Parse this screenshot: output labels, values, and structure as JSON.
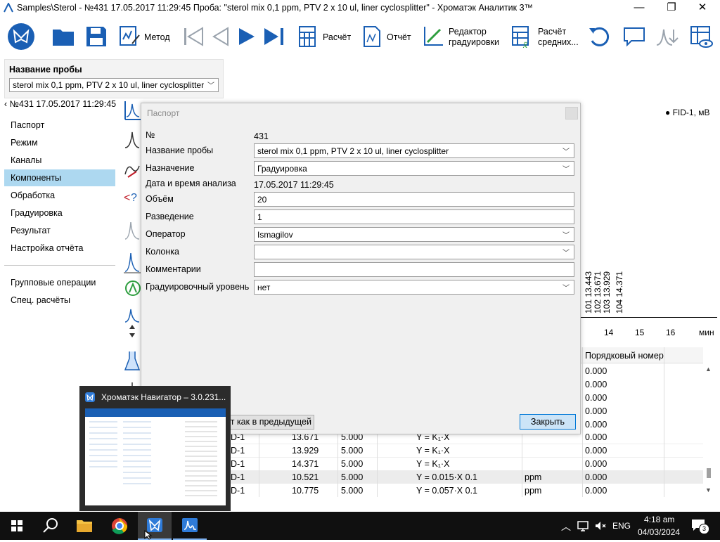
{
  "window": {
    "title": "Samples\\Sterol - №431 17.05.2017 11:29:45        Проба: \"sterol mix 0,1 ppm, PTV 2 x 10 ul, liner cyclosplitter\" - Хроматэк Аналитик 3™",
    "minimize_glyph": "—",
    "maximize_glyph": "❐",
    "close_glyph": "✕"
  },
  "toolbar": {
    "method_label": "Метод",
    "calc_label": "Расчёт",
    "report_label": "Отчёт",
    "editor_label_1": "Редактор",
    "editor_label_2": "градуировки",
    "calc_avg_label_1": "Расчёт",
    "calc_avg_label_2": "средних..."
  },
  "sample": {
    "header": "Название пробы",
    "value": "sterol mix 0,1 ppm, PTV 2 x 10 ul, liner cyclosplitter"
  },
  "nav": {
    "back_label": "‹ №431 17.05.2017 11:29:45",
    "items": [
      "Паспорт",
      "Режим",
      "Каналы",
      "Компоненты",
      "Обработка",
      "Градуировка",
      "Результат",
      "Настройка отчёта"
    ],
    "extra_items": [
      "Групповые операции",
      "Спец. расчёты"
    ],
    "selected": "Компоненты"
  },
  "chart": {
    "legend": "FID-1, мВ",
    "peak_labels": [
      "101 13.443",
      "102 13.671",
      "103 13.929",
      "104 14.371"
    ],
    "x_ticks": [
      "14",
      "15",
      "16"
    ],
    "x_unit": "мин"
  },
  "dialog": {
    "title": "Паспорт",
    "number_label": "№",
    "number_value": "431",
    "sample_name_label": "Название пробы",
    "sample_name_value": "sterol mix 0,1 ppm, PTV 2 x 10 ul, liner cyclosplitter",
    "purpose_label": "Назначение",
    "purpose_value": "Градуировка",
    "datetime_label": "Дата и время анализа",
    "datetime_value": "17.05.2017 11:29:45",
    "volume_label": "Объём",
    "volume_value": "20",
    "dilution_label": "Разведение",
    "dilution_value": "1",
    "operator_label": "Оператор",
    "operator_value": "Ismagilov",
    "column_label": "Колонка",
    "column_value": "",
    "comments_label": "Комментарии",
    "comments_value": "",
    "level_label": "Градуировочный уровень",
    "level_value": "нет",
    "as_previous_label": "от как в предыдущей",
    "close_label": "Закрыть"
  },
  "table": {
    "order_header": "Порядковый номер",
    "order_values": [
      "0.000",
      "0.000",
      "0.000",
      "0.000",
      "0.000"
    ],
    "rows": [
      {
        "name": "D-1",
        "time": "13.671",
        "conc": "5.000",
        "formula": "Y = K₁·X",
        "unit": "",
        "order": "0.000"
      },
      {
        "name": "D-1",
        "time": "13.929",
        "conc": "5.000",
        "formula": "Y = K₁·X",
        "unit": "",
        "order": "0.000"
      },
      {
        "name": "D-1",
        "time": "14.371",
        "conc": "5.000",
        "formula": "Y = K₁·X",
        "unit": "",
        "order": "0.000"
      },
      {
        "name": "D-1",
        "time": "10.521",
        "conc": "5.000",
        "formula": "Y = 0.015·X 0.1",
        "unit": "ppm",
        "order": "0.000"
      },
      {
        "name": "D-1",
        "time": "10.775",
        "conc": "5.000",
        "formula": "Y = 0.057·X 0.1",
        "unit": "ppm",
        "order": "0.000"
      }
    ]
  },
  "taskbar_preview": {
    "title": "Хроматэк Навигатор – 3.0.231..."
  },
  "tray": {
    "language": "ENG",
    "time": "4:18 am",
    "date": "04/03/2024",
    "notification_count": "3"
  },
  "colors": {
    "accent": "#1a5fb4",
    "nav_selected": "#add8f0",
    "taskbar": "#101010",
    "close_button": "#cce4f7"
  }
}
